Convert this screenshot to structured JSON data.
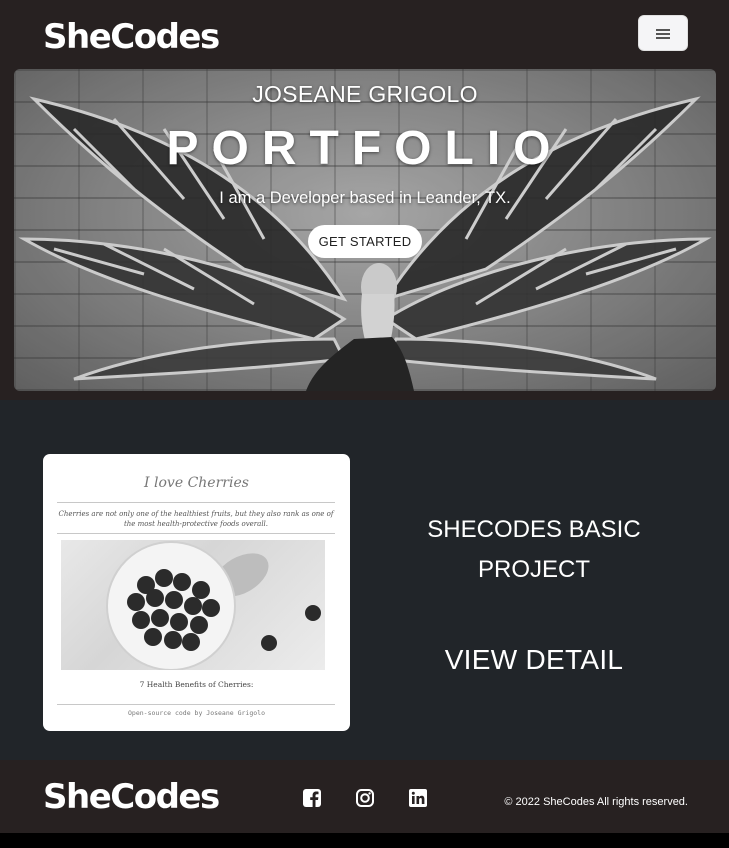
{
  "navbar": {
    "brand": "SheCodes",
    "menu_icon": "hamburger-icon"
  },
  "hero": {
    "name": "JOSEANE GRIGOLO",
    "title": "PORTFOLIO",
    "subtitle": "I am a Developer based in Leander, TX.",
    "button_label": "GET STARTED"
  },
  "project": {
    "preview": {
      "title": "I love Cherries",
      "description": "Cherries are not only one of the healthiest fruits, but they also rank as one of the most health-protective foods overall.",
      "caption": "7 Health Benefits of Cherries:",
      "footer": "Open-source code by Joseane Grigolo"
    },
    "title": "SHECODES BASIC PROJECT",
    "link_label": "VIEW DETAIL"
  },
  "footer": {
    "brand": "SheCodes",
    "social_icons": [
      "facebook-icon",
      "instagram-icon",
      "linkedin-icon"
    ],
    "copyright": "© 2022 SheCodes All rights reserved."
  },
  "colors": {
    "navbar_bg": "#272121",
    "project_bg": "#212529",
    "page_bg": "#000000"
  }
}
